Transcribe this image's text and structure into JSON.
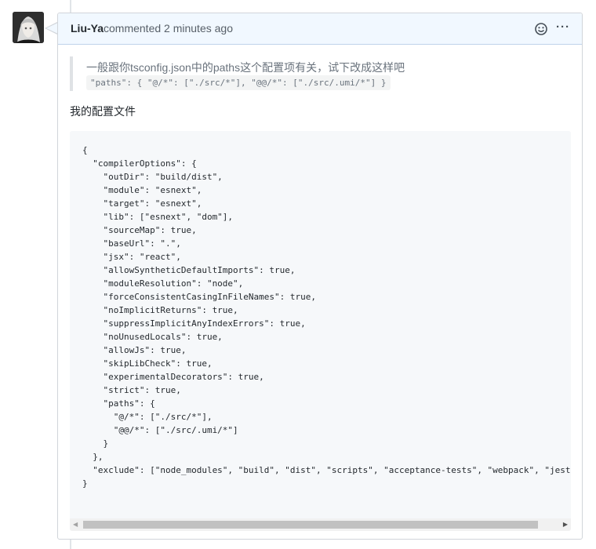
{
  "comment": {
    "author": "Liu-Ya",
    "action": "commented 2 minutes ago",
    "more_label": "···"
  },
  "quote": {
    "text": "一般跟你tsconfig.json中的paths这个配置项有关，试下改成这样吧",
    "code": "\"paths\": { \"@/*\": [\"./src/*\"], \"@@/*\": [\"./src/.umi/*\"] }"
  },
  "paragraph": "我的配置文件",
  "code_lines": [
    "{",
    "  \"compilerOptions\": {",
    "    \"outDir\": \"build/dist\",",
    "    \"module\": \"esnext\",",
    "    \"target\": \"esnext\",",
    "    \"lib\": [\"esnext\", \"dom\"],",
    "    \"sourceMap\": true,",
    "    \"baseUrl\": \".\",",
    "    \"jsx\": \"react\",",
    "    \"allowSyntheticDefaultImports\": true,",
    "    \"moduleResolution\": \"node\",",
    "    \"forceConsistentCasingInFileNames\": true,",
    "    \"noImplicitReturns\": true,",
    "    \"suppressImplicitAnyIndexErrors\": true,",
    "    \"noUnusedLocals\": true,",
    "    \"allowJs\": true,",
    "    \"skipLibCheck\": true,",
    "    \"experimentalDecorators\": true,",
    "    \"strict\": true,",
    "    \"paths\": {",
    "      \"@/*\": [\"./src/*\"],",
    "      \"@@/*\": [\"./src/.umi/*\"]",
    "    }",
    "  },",
    "  \"exclude\": [\"node_modules\", \"build\", \"dist\", \"scripts\", \"acceptance-tests\", \"webpack\", \"jest\"",
    "}"
  ],
  "icons": {
    "emoji": "smiley-icon",
    "more": "kebab-horizontal-icon",
    "scroll_left": "triangle-left-icon",
    "scroll_right": "triangle-right-icon"
  },
  "colors": {
    "header_bg": "#f1f8ff",
    "code_bg": "#f6f8fa",
    "border": "#d1d5da"
  }
}
